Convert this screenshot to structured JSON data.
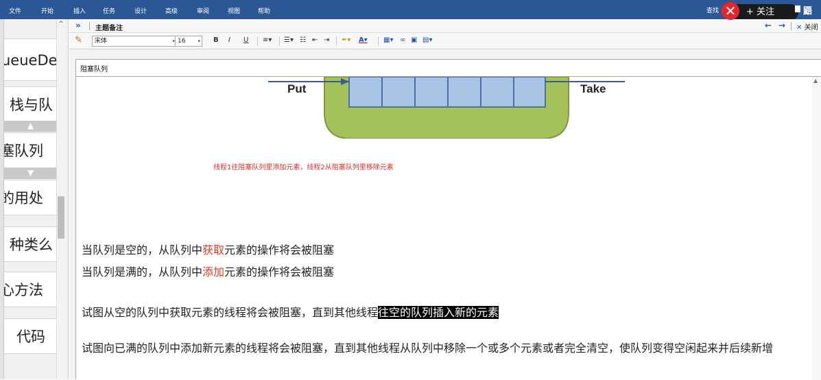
{
  "menu": {
    "items": [
      "文件",
      "开始",
      "插入",
      "任务",
      "设计",
      "高级",
      "审阅",
      "视图",
      "帮助"
    ],
    "find": "查找",
    "follow_label": "+ 关注",
    "user_initial": "鼯"
  },
  "outline": {
    "nodes": [
      "ueueDe",
      "栈与队",
      "塞队列",
      "的用处",
      "种类么",
      "心方法",
      "代码"
    ]
  },
  "notes_panel": {
    "title": "主题备注",
    "close_label": "关闭",
    "expand_glyph": "»",
    "back_glyph": "←",
    "forward_glyph": "→"
  },
  "toolbar": {
    "font": "宋体",
    "size": "16",
    "bold": "B",
    "italic": "I",
    "underline": "U"
  },
  "document": {
    "title": "阻塞队列",
    "diagram": {
      "put_label": "Put",
      "take_label": "Take"
    },
    "caption": "线程1往阻塞队列里添加元素，线程2从阻塞队列里移除元素",
    "para1": {
      "before": "当队列是空的，从队列中",
      "highlight": "获取",
      "after": "元素的操作将会被阻塞"
    },
    "para2": {
      "before": "当队列是满的，从队列中",
      "highlight": "添加",
      "after": "元素的操作将会被阻塞"
    },
    "para3": {
      "before": "试图从空的队列中获取元素的线程将会被阻塞，直到其他线程",
      "selected": "往空的队列插入新的元素"
    },
    "para4": "试图向已满的队列中添加新元素的线程将会被阻塞，直到其他线程从队列中移除一个或多个元素或者完全清空，使队列变得空闲起来并后续新增"
  },
  "colors": {
    "menubar": "#2b5797",
    "highlight_red": "#e03a2a",
    "caption_red": "#e0302f",
    "queue_green": "#a4c15a",
    "queue_slot_blue": "#a9c4e4"
  }
}
